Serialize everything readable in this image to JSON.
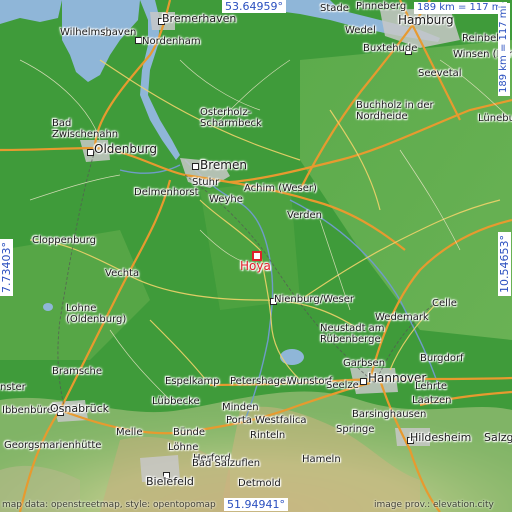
{
  "map": {
    "target": "Hoya",
    "coordinates": {
      "top": "53.64959°",
      "bottom": "51.94941°",
      "left": "7.73403°",
      "right": "10.54653°"
    },
    "scale": {
      "horizontal": "189 km = 117 mi",
      "vertical": "189 km = 117 mi"
    },
    "attribution_left": "map data: openstreetmap, style: opentopomap",
    "attribution_right": "image prov.: elevation.city",
    "places": [
      {
        "id": "bremerhaven",
        "label": "Bremerhaven"
      },
      {
        "id": "wilhelmshaven",
        "label": "Wilhelmshaven"
      },
      {
        "id": "nordenham",
        "label": "Nordenham"
      },
      {
        "id": "stade",
        "label": "Stade"
      },
      {
        "id": "pinneberg",
        "label": "Pinneberg"
      },
      {
        "id": "hamburg",
        "label": "Hamburg"
      },
      {
        "id": "wedel",
        "label": "Wedel"
      },
      {
        "id": "buxtehude",
        "label": "Buxtehude"
      },
      {
        "id": "reinbek",
        "label": "Reinbek"
      },
      {
        "id": "seevetal",
        "label": "Seevetal"
      },
      {
        "id": "winsen",
        "label": "Winsen (Luhe)"
      },
      {
        "id": "luneburg",
        "label": "Lüneburg"
      },
      {
        "id": "badzwischenahn",
        "label": "Bad\nZwischenahn"
      },
      {
        "id": "osterholz",
        "label": "Osterholz-\nScharmbeck"
      },
      {
        "id": "buchholz",
        "label": "Buchholz in der\nNordheide"
      },
      {
        "id": "oldenburg",
        "label": "Oldenburg"
      },
      {
        "id": "bremen",
        "label": "Bremen"
      },
      {
        "id": "stuhr",
        "label": "Stuhr"
      },
      {
        "id": "delmenhorst",
        "label": "Delmenhorst"
      },
      {
        "id": "achim",
        "label": "Achim (Weser)"
      },
      {
        "id": "weyhe",
        "label": "Weyhe"
      },
      {
        "id": "verden",
        "label": "Verden"
      },
      {
        "id": "cloppenburg",
        "label": "Cloppenburg"
      },
      {
        "id": "hoya",
        "label": "Hoya"
      },
      {
        "id": "vechta",
        "label": "Vechta"
      },
      {
        "id": "nienburg",
        "label": "Nienburg/Weser"
      },
      {
        "id": "lohne",
        "label": "Lohne\n(Oldenburg)"
      },
      {
        "id": "celle",
        "label": "Celle"
      },
      {
        "id": "wedemark",
        "label": "Wedemark"
      },
      {
        "id": "neustadt",
        "label": "Neustadt am\nRübenberge"
      },
      {
        "id": "burgdorf",
        "label": "Burgdorf"
      },
      {
        "id": "bramsche",
        "label": "Bramsche"
      },
      {
        "id": "garbsen",
        "label": "Garbsen"
      },
      {
        "id": "espelkamp",
        "label": "Espelkamp"
      },
      {
        "id": "petershagen",
        "label": "Petershagen"
      },
      {
        "id": "wunstorf",
        "label": "Wunstorf"
      },
      {
        "id": "hannover",
        "label": "Hannover"
      },
      {
        "id": "seelze",
        "label": "Seelze"
      },
      {
        "id": "lehrte",
        "label": "Lehrte"
      },
      {
        "id": "laatzen",
        "label": "Laatzen"
      },
      {
        "id": "ibbenburen",
        "label": "Ibbenbüren"
      },
      {
        "id": "osnabruck",
        "label": "Osnabrück"
      },
      {
        "id": "lubbecke",
        "label": "Lübbecke"
      },
      {
        "id": "minden",
        "label": "Minden"
      },
      {
        "id": "barsinghausen",
        "label": "Barsinghausen"
      },
      {
        "id": "portawestfalica",
        "label": "Porta Westfalica"
      },
      {
        "id": "springe",
        "label": "Springe"
      },
      {
        "id": "melle",
        "label": "Melle"
      },
      {
        "id": "bunde",
        "label": "Bünde"
      },
      {
        "id": "rinteln",
        "label": "Rinteln"
      },
      {
        "id": "hildesheim",
        "label": "Hildesheim"
      },
      {
        "id": "salzgitter",
        "label": "Salzg"
      },
      {
        "id": "georgsmarienhutte",
        "label": "Georgsmarienhütte"
      },
      {
        "id": "herford",
        "label": "Herford"
      },
      {
        "id": "lohne2",
        "label": "Löhne"
      },
      {
        "id": "badsalzuflen",
        "label": "Bad Salzuflen"
      },
      {
        "id": "hameln",
        "label": "Hameln"
      },
      {
        "id": "bielefeld",
        "label": "Bielefeld"
      },
      {
        "id": "detmold",
        "label": "Detmold"
      },
      {
        "id": "munster",
        "label": "nster"
      }
    ]
  }
}
